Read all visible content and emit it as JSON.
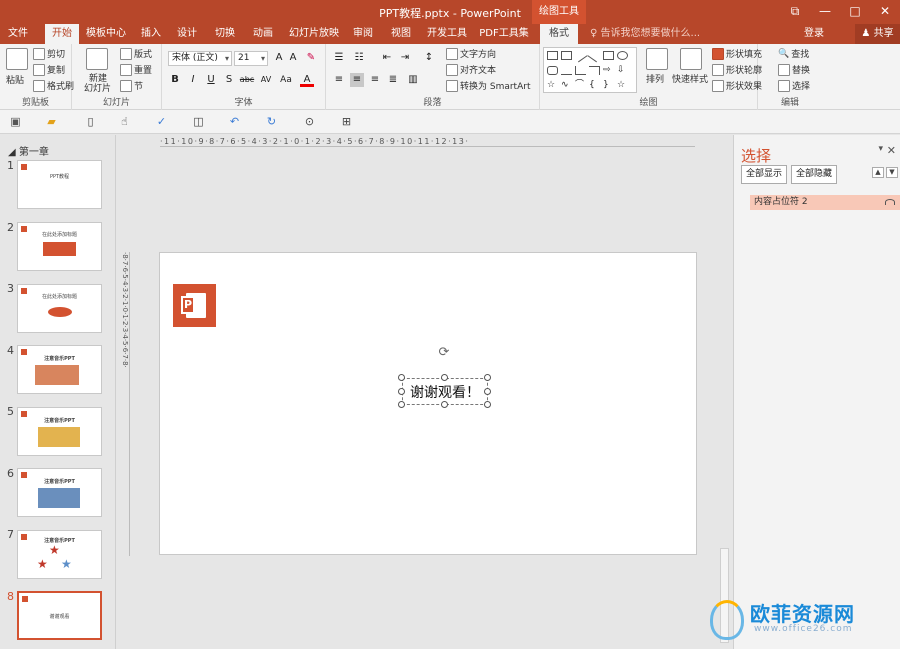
{
  "window": {
    "title": "PPT教程.pptx - PowerPoint",
    "context_tools": "绘图工具",
    "buttons": [
      "⧉",
      "—",
      "□",
      "✕"
    ]
  },
  "tabs": [
    {
      "label": "文件"
    },
    {
      "label": "开始"
    },
    {
      "label": "模板中心"
    },
    {
      "label": "插入"
    },
    {
      "label": "设计"
    },
    {
      "label": "切换"
    },
    {
      "label": "动画"
    },
    {
      "label": "幻灯片放映"
    },
    {
      "label": "审阅"
    },
    {
      "label": "视图"
    },
    {
      "label": "开发工具"
    },
    {
      "label": "PDF工具集"
    },
    {
      "label": "格式"
    }
  ],
  "tellme": "告诉我您想要做什么...",
  "login": "登录",
  "share": "共享",
  "ribbon": {
    "clipboard": {
      "label": "剪贴板",
      "paste": "粘贴",
      "cut": "剪切",
      "copy": "复制",
      "format_painter": "格式刷"
    },
    "slides": {
      "label": "幻灯片",
      "new_slide": "新建",
      "new_slide2": "幻灯片",
      "layout": "版式",
      "reset": "重置",
      "section": "节"
    },
    "font": {
      "label": "字体",
      "font_name": "宋体 (正文)",
      "font_size": "21",
      "bold": "B",
      "italic": "I",
      "underline": "U",
      "shadow": "S",
      "strike": "abc",
      "spacing": "AV",
      "case": "Aa",
      "color": "A"
    },
    "paragraph": {
      "label": "段落",
      "text_direction": "文字方向",
      "align_text": "对齐文本",
      "smartart": "转换为 SmartArt"
    },
    "drawing": {
      "label": "绘图",
      "arrange": "排列",
      "quick_styles": "快速样式",
      "fill": "形状填充",
      "outline": "形状轮廓",
      "effects": "形状效果"
    },
    "editing": {
      "label": "编辑",
      "find": "查找",
      "replace": "替换",
      "select": "选择"
    }
  },
  "thumbnails": {
    "section": "第一章",
    "slides": [
      {
        "num": "1",
        "title": "PPT教程"
      },
      {
        "num": "2",
        "title": "在此处添加标题"
      },
      {
        "num": "3",
        "title": "在此处添加标题"
      },
      {
        "num": "4",
        "title": "注意音乐PPT"
      },
      {
        "num": "5",
        "title": "注意音乐PPT"
      },
      {
        "num": "6",
        "title": "注意音乐PPT"
      },
      {
        "num": "7",
        "title": "注意音乐PPT"
      },
      {
        "num": "8",
        "title": "谢谢观看"
      }
    ]
  },
  "ruler_h": "·11·10·9·8·7·6·5·4·3·2·1·0·1·2·3·4·5·6·7·8·9·10·11·12·13·",
  "ruler_v": "·8·7·6·5·4·3·2·1·0·1·2·3·4·5·6·7·8·",
  "slide": {
    "text": "谢谢观看！",
    "logo_letter": "P"
  },
  "selection_pane": {
    "title": "选择",
    "show_all": "全部显示",
    "hide_all": "全部隐藏",
    "items": [
      {
        "label": "内容占位符 2"
      }
    ]
  },
  "watermark": {
    "text": "欧菲资源网",
    "url": "www.office26.com"
  },
  "colors": {
    "accent": "#b7472a",
    "accent_light": "#d35230",
    "selection": "#f8c8b7"
  }
}
